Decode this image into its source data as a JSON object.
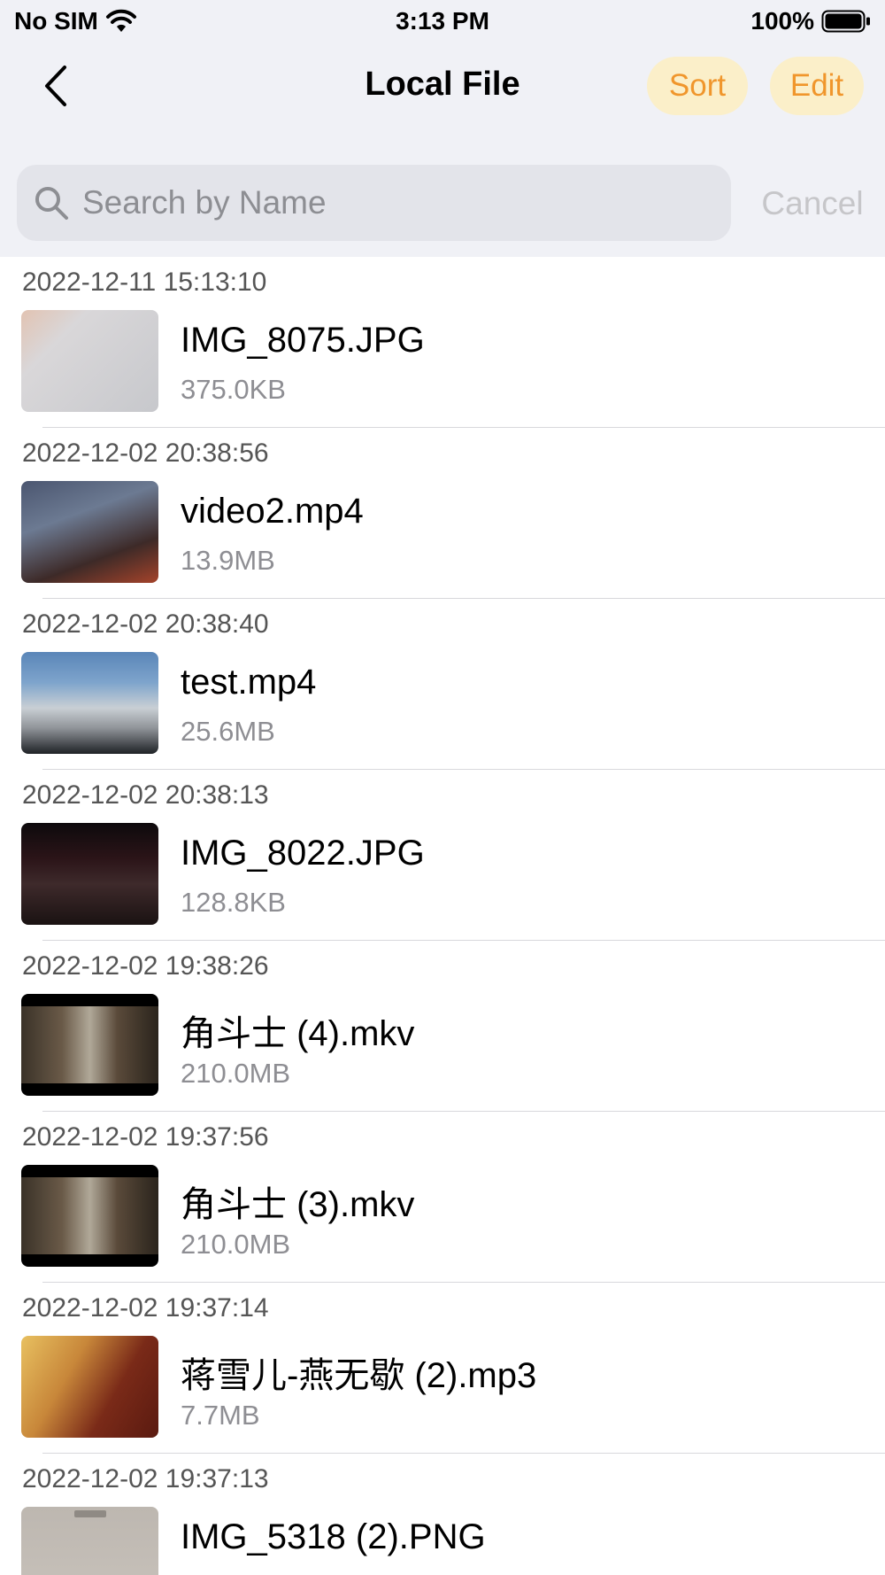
{
  "status_bar": {
    "carrier": "No SIM",
    "time": "3:13 PM",
    "battery": "100%"
  },
  "nav": {
    "title": "Local File",
    "sort_label": "Sort",
    "edit_label": "Edit"
  },
  "search": {
    "placeholder": "Search by Name",
    "value": "",
    "cancel_label": "Cancel"
  },
  "colors": {
    "accent": "#f0962c",
    "pill_bg": "#fbefc9",
    "header_bg": "#f0f1f6"
  },
  "files": [
    {
      "date": "2022-12-11 15:13:10",
      "name": "IMG_8075.JPG",
      "size": "375.0KB",
      "thumb": "keyboard-photo"
    },
    {
      "date": "2022-12-02 20:38:56",
      "name": "video2.mp4",
      "size": "13.9MB",
      "thumb": "fire-video"
    },
    {
      "date": "2022-12-02 20:38:40",
      "name": "test.mp4",
      "size": "25.6MB",
      "thumb": "street-video"
    },
    {
      "date": "2022-12-02 20:38:13",
      "name": "IMG_8022.JPG",
      "size": "128.8KB",
      "thumb": "night-photo"
    },
    {
      "date": "2022-12-02 19:38:26",
      "name": "角斗士 (4).mkv",
      "size": "210.0MB",
      "thumb": "film-still"
    },
    {
      "date": "2022-12-02 19:37:56",
      "name": "角斗士 (3).mkv",
      "size": "210.0MB",
      "thumb": "film-still"
    },
    {
      "date": "2022-12-02 19:37:14",
      "name": "蒋雪儿-燕无歇 (2).mp3",
      "size": "7.7MB",
      "thumb": "music-cover"
    },
    {
      "date": "2022-12-02 19:37:13",
      "name": "IMG_5318 (2).PNG",
      "size": "",
      "thumb": "screenshot"
    }
  ]
}
